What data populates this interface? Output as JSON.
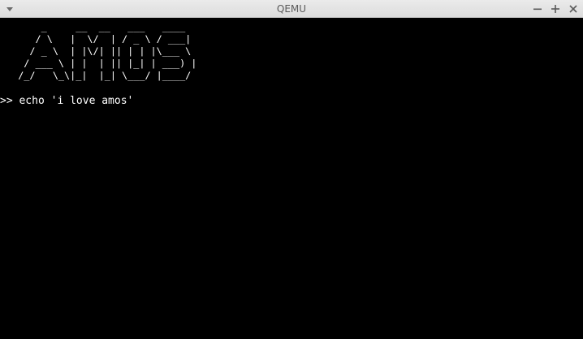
{
  "window": {
    "title": "QEMU",
    "controls": {
      "menu_icon": "chevron-down-icon",
      "minimize_icon": "minimize-icon",
      "maximize_icon": "plus-icon",
      "close_icon": "close-icon"
    }
  },
  "terminal": {
    "logo_lines": [
      "      _     __  __   ___   ____",
      "     / \\   |  \\/  | / _ \\ / ___|",
      "    / _ \\  | |\\/| || | | |\\___ \\",
      "   / ___ \\ | |  | || |_| | ___) |",
      "  /_/   \\_\\|_|  |_| \\___/ |____/"
    ],
    "prompt": ">>",
    "command": "echo 'i love amos'"
  },
  "colors": {
    "screen_bg": "#000000",
    "text": "#ffffff",
    "titlebar_bg": "#e4e4e4",
    "title_text": "#5a5a5a"
  }
}
